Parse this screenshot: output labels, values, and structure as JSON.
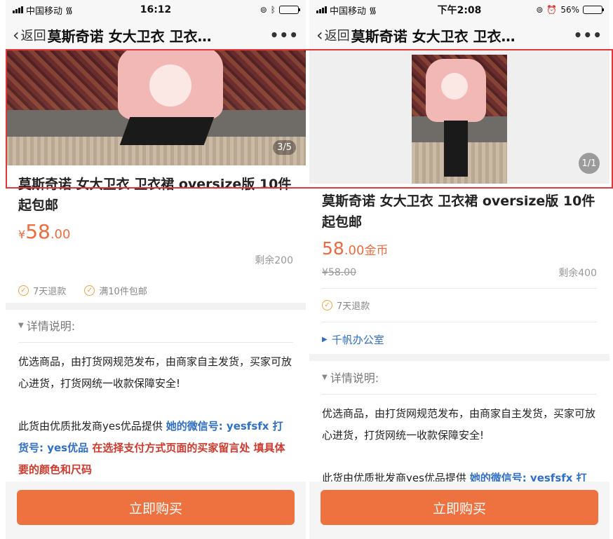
{
  "left": {
    "status": {
      "carrier": "中国移动",
      "time": "16:12"
    },
    "nav": {
      "back_label": "返回",
      "title": "莫斯奇诺 女大卫衣 卫衣…"
    },
    "gallery": {
      "counter": "3/5"
    },
    "product": {
      "title": "莫斯奇诺 女大卫衣 卫衣裙 oversize版 10件起包邮",
      "price_symbol": "¥",
      "price_int": "58",
      "price_dec": ".00",
      "stock": "剩余200"
    },
    "tags": [
      "7天退款",
      "满10件包邮"
    ],
    "details": {
      "heading": "详情说明:",
      "para1": "优选商品，由打货网规范发布，由商家自主发货，买家可放心进货，打货网统一收款保障安全!",
      "para2_plain": "此货由优质批发商yes优品提供 ",
      "para2_blue": "她的微信号: yesfsfx 打货号: yes优品 ",
      "para2_red": "在选择支付方式页面的买家留言处 填具体要的颜色和尺码"
    },
    "buy_label": "立即购买"
  },
  "right": {
    "status": {
      "carrier": "中国移动",
      "time": "下午2:08",
      "battery": "56%"
    },
    "nav": {
      "back_label": "返回",
      "title": "莫斯奇诺 女大卫衣 卫衣…"
    },
    "gallery": {
      "counter": "1/1"
    },
    "product": {
      "title": "莫斯奇诺 女大卫衣 卫衣裙 oversize版 10件起包邮",
      "price_int": "58",
      "price_dec": ".00",
      "price_unit": "金币",
      "old_price": "¥58.00",
      "stock": "剩余400"
    },
    "tags": [
      "7天退款"
    ],
    "office_link": "千帆办公室",
    "details": {
      "heading": "详情说明:",
      "para1": "优选商品，由打货网规范发布，由商家自主发货，买家可放心进货，打货网统一收款保障安全!",
      "para2_plain": "此货由优质批发商yes优品提供 ",
      "para2_blue": "她的微信号: yesfsfx 打"
    },
    "buy_label": "立即购买"
  },
  "colors": {
    "accent": "#ee7240",
    "price": "#ef6b3e",
    "link": "#2f6fc7",
    "warning": "#d0392c",
    "highlight_frame": "#e0373a"
  },
  "icons": [
    "signal-icon",
    "wifi-icon",
    "battery-icon",
    "bluetooth-icon",
    "alarm-icon",
    "orientation-lock-icon",
    "back-chevron-icon",
    "more-dots-icon",
    "check-circle-icon",
    "triangle-down-icon",
    "triangle-right-icon"
  ]
}
